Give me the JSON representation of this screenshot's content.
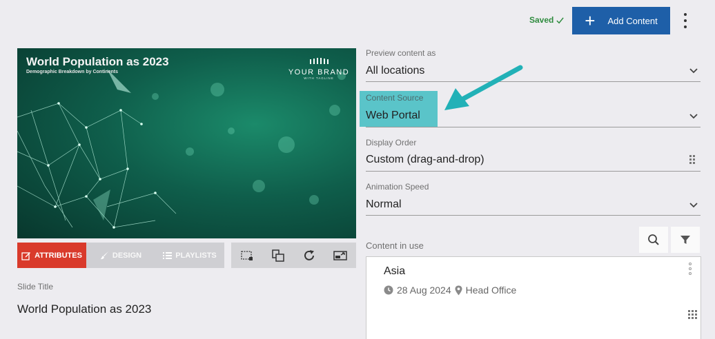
{
  "header": {
    "saved_label": "Saved",
    "add_content_label": "Add Content"
  },
  "preview": {
    "slide_title": "World Population as 2023",
    "slide_subtitle": "Demographic Breakdown by Continents",
    "brand_name": "YOUR BRAND",
    "brand_tagline": "WITH TAGLINE"
  },
  "tabs": {
    "attributes": "ATTRIBUTES",
    "design": "DESIGN",
    "playlists": "PLAYLISTS"
  },
  "slide_title_field": {
    "label": "Slide Title",
    "value": "World Population as 2023"
  },
  "fields": {
    "preview_as": {
      "label": "Preview content as",
      "value": "All locations"
    },
    "content_source": {
      "label": "Content Source",
      "value": "Web Portal"
    },
    "display_order": {
      "label": "Display Order",
      "value": "Custom (drag-and-drop)"
    },
    "animation_speed": {
      "label": "Animation Speed",
      "value": "Normal"
    }
  },
  "content_in_use": {
    "label": "Content in use",
    "items": [
      {
        "title": "Asia",
        "date": "28 Aug 2024",
        "location": "Head Office"
      }
    ]
  },
  "colors": {
    "accent_blue": "#1e5fa8",
    "attributes_tab": "#d93a2b",
    "highlight": "#5ac4c9",
    "arrow": "#22b1b7",
    "saved_green": "#2e8b3e"
  },
  "icons": [
    "check-icon",
    "plus-icon",
    "kebab-icon",
    "edit-icon",
    "brush-icon",
    "list-icon",
    "crop-icon",
    "layers-icon",
    "refresh-icon",
    "cast-icon",
    "chevron-down-icon",
    "drag-handle-icon",
    "search-icon",
    "filter-icon",
    "clock-icon",
    "pin-icon"
  ]
}
